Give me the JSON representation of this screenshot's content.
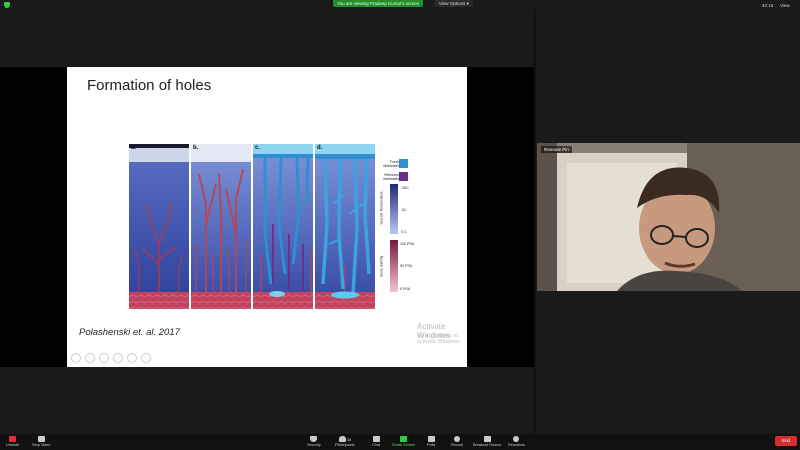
{
  "topbar": {
    "share_banner": "You are viewing Pradeep Kumar's screen",
    "view_options": "View Options ▾",
    "clock": "42:16",
    "view_label": "View"
  },
  "slide": {
    "title": "Formation of holes",
    "citation": "Polashenski et. al. 2017",
    "watermark_title": "Activate Windows",
    "watermark_sub": "Go to Settings to activate Windows.",
    "panel_labels": [
      "a.",
      "b.",
      "c.",
      "d."
    ],
    "legend": {
      "fresh_meltwater": "Fresh Meltwater",
      "refrozen_meltwater": "Refrozen Meltwater",
      "temp_axis": "Sea Ice Temperature",
      "temp_ticks": [
        "-20C",
        "-5C",
        "0 C"
      ],
      "salinity_axis": "Brine Salinity",
      "salinity_ticks": [
        "100 PSU",
        "50 PSU",
        "0 PSU"
      ]
    }
  },
  "video": {
    "participant_name": "Ramone Pin"
  },
  "toolbar": {
    "unmute": "Unmute",
    "stop_video": "Stop Video",
    "security": "Security",
    "participants": "Participants",
    "participants_count": "38",
    "chat": "Chat",
    "share_screen": "Share Screen",
    "polls": "Polls",
    "record": "Record",
    "breakout_rooms": "Breakout Rooms",
    "reactions": "Reactions",
    "end": "End"
  },
  "colors": {
    "share_green": "#1f8f2e",
    "end_red": "#d32f2f",
    "ice_blue": "#3a52a8",
    "brine_red": "#b03a4a",
    "meltwater": "#2f8fd0",
    "refrozen": "#6a2d8a"
  }
}
